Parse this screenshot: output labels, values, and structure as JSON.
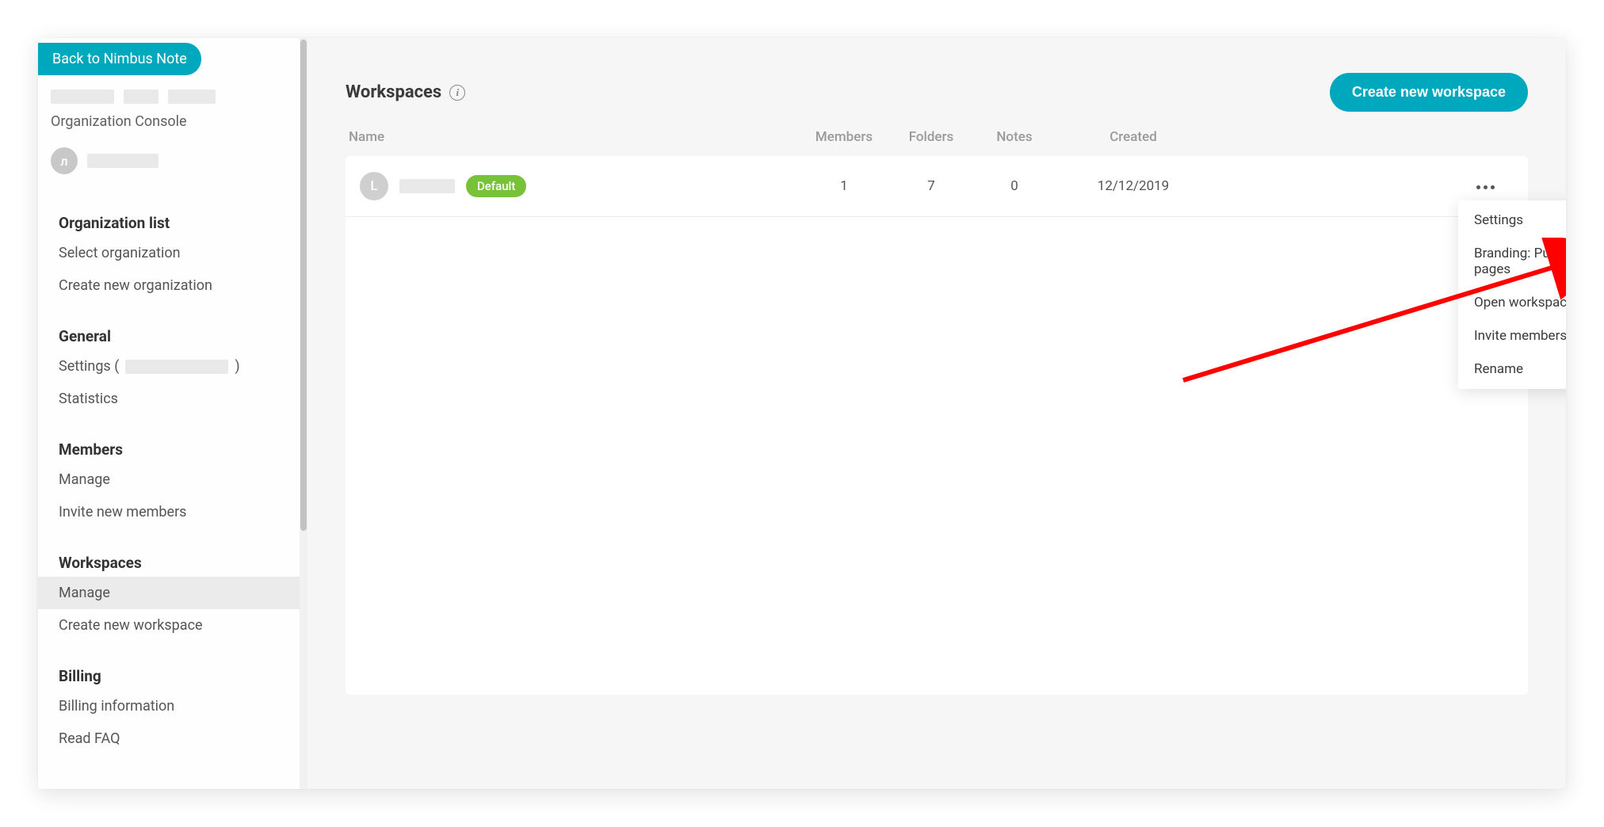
{
  "sidebar": {
    "back_label": "Back to Nimbus Note",
    "console_label": "Organization Console",
    "user_avatar_letter": "л",
    "sections": {
      "org": {
        "header": "Organization list",
        "select": "Select organization",
        "create": "Create new organization"
      },
      "general": {
        "header": "General",
        "settings_prefix": "Settings (",
        "settings_suffix": ")",
        "statistics": "Statistics"
      },
      "members": {
        "header": "Members",
        "manage": "Manage",
        "invite": "Invite new members"
      },
      "workspaces": {
        "header": "Workspaces",
        "manage": "Manage",
        "create": "Create new workspace"
      },
      "billing": {
        "header": "Billing",
        "info": "Billing information",
        "faq": "Read FAQ"
      }
    }
  },
  "main": {
    "title": "Workspaces",
    "create_button": "Create new workspace",
    "columns": {
      "name": "Name",
      "members": "Members",
      "folders": "Folders",
      "notes": "Notes",
      "created": "Created"
    },
    "rows": [
      {
        "avatar_letter": "L",
        "default_label": "Default",
        "members": "1",
        "folders": "7",
        "notes": "0",
        "created": "12/12/2019"
      }
    ]
  },
  "dropdown": {
    "settings": "Settings",
    "branding": "Branding: Public pages",
    "open": "Open workspace",
    "invite": "Invite members",
    "rename": "Rename"
  }
}
